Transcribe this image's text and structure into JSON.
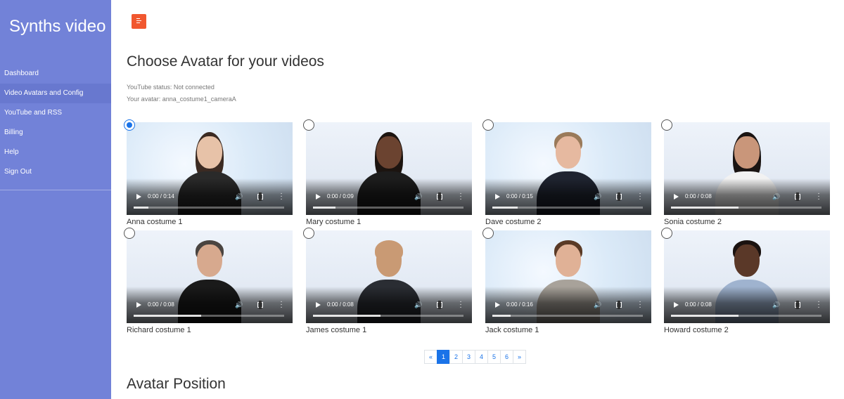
{
  "sidebar": {
    "brand": "Synths video",
    "items": [
      {
        "label": "Dashboard"
      },
      {
        "label": "Video Avatars and Config"
      },
      {
        "label": "YouTube and RSS"
      },
      {
        "label": "Billing"
      },
      {
        "label": "Help"
      },
      {
        "label": "Sign Out"
      }
    ],
    "active_index": 1
  },
  "header": {
    "menu_icon": "menu-icon",
    "title": "Choose Avatar for your videos",
    "youtube_status": "YouTube status: Not connected",
    "your_avatar": "Your avatar: anna_costume1_cameraA"
  },
  "avatars": [
    {
      "name": "Anna costume 1",
      "time": "0:00 / 0:14",
      "selected": true,
      "progress": 0.1
    },
    {
      "name": "Mary costume 1",
      "time": "0:00 / 0:09",
      "selected": false,
      "progress": 0.15
    },
    {
      "name": "Dave costume 2",
      "time": "0:00 / 0:15",
      "selected": false,
      "progress": 0.17
    },
    {
      "name": "Sonia costume 2",
      "time": "0:00 / 0:08",
      "selected": false,
      "progress": 0.45
    },
    {
      "name": "Richard costume 1",
      "time": "0:00 / 0:08",
      "selected": false,
      "progress": 0.45
    },
    {
      "name": "James costume 1",
      "time": "0:00 / 0:08",
      "selected": false,
      "progress": 0.45
    },
    {
      "name": "Jack costume 1",
      "time": "0:00 / 0:16",
      "selected": false,
      "progress": 0.12
    },
    {
      "name": "Howard costume 2",
      "time": "0:00 / 0:08",
      "selected": false,
      "progress": 0.45
    }
  ],
  "pagination": {
    "prev": "«",
    "pages": [
      "1",
      "2",
      "3",
      "4",
      "5",
      "6"
    ],
    "next": "»",
    "active": "1"
  },
  "section": {
    "title": "Avatar Position"
  },
  "colors": {
    "sidebar": "#7282d8",
    "accent": "#1a73e8",
    "menu_button": "#f1572f"
  }
}
